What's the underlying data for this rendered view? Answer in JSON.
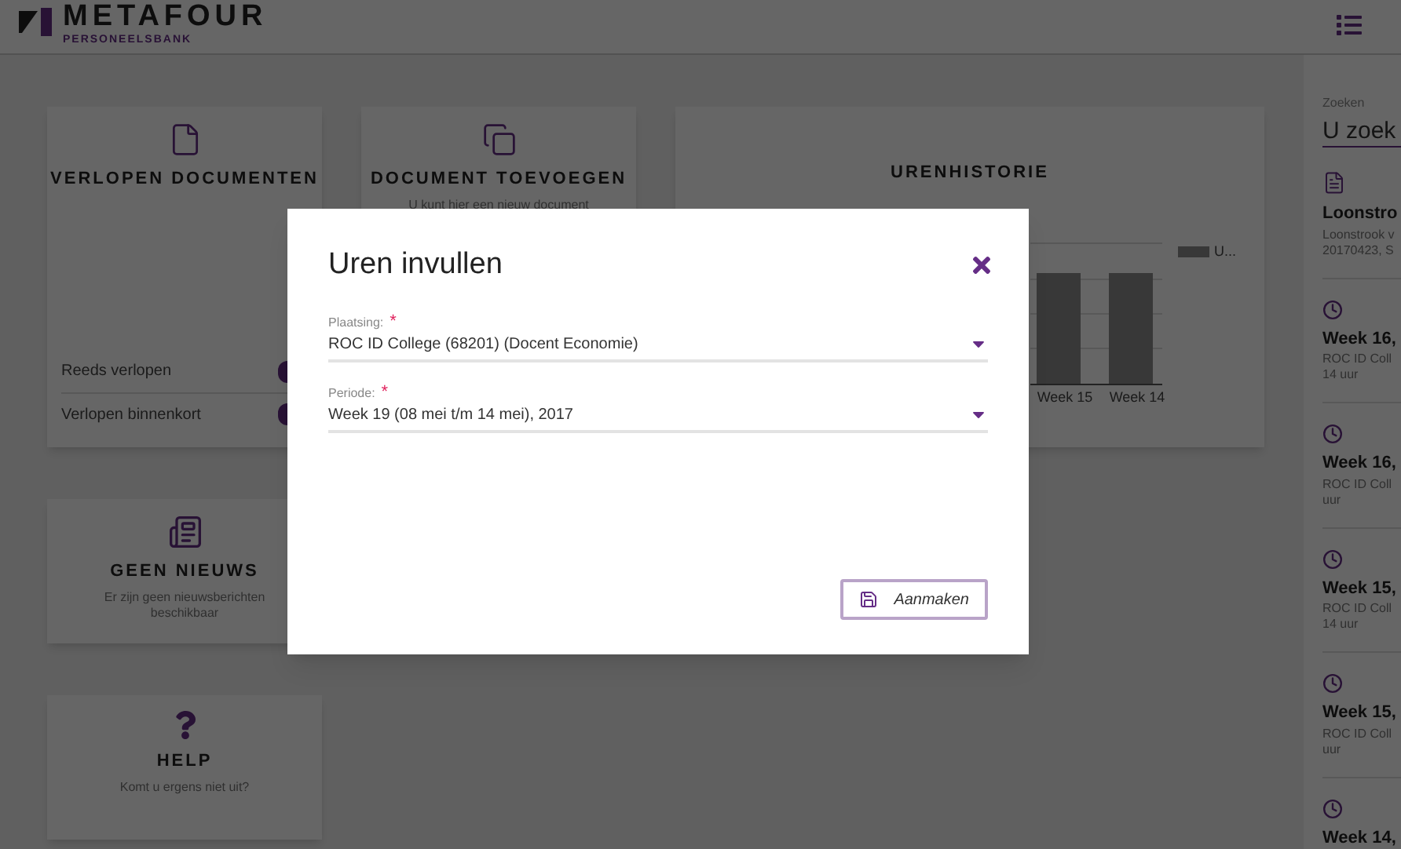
{
  "header": {
    "logo_name": "METAFOUR",
    "logo_subtitle": "PERSONEELSBANK"
  },
  "cards": [
    {
      "kind": "expired",
      "title": "VERLOPEN DOCUMENTEN",
      "rows": [
        "Reeds verlopen",
        "Verlopen binnenkort"
      ]
    },
    {
      "kind": "add",
      "title": "DOCUMENT TOEVOEGEN",
      "text": "U kunt hier een nieuw document"
    },
    {
      "kind": "chart",
      "title": "URENHISTORIE",
      "x_labels": [
        "Week 15",
        "Week 14"
      ],
      "legend": "U..."
    },
    {
      "kind": "news",
      "title": "GEEN NIEUWS",
      "text": "Er zijn geen nieuwsberichten beschikbaar"
    },
    {
      "kind": "help",
      "title": "HELP",
      "text": "Komt u ergens niet uit?"
    }
  ],
  "sidebar": {
    "search_label": "Zoeken",
    "search_placeholder": "U zoek",
    "items": [
      {
        "kind": "document",
        "title": "Loonstro",
        "lines": [
          "Loonstrook v",
          "20170423, S"
        ]
      },
      {
        "kind": "hours",
        "title": "Week 16,",
        "lines": [
          "ROC ID Coll",
          "14 uur"
        ]
      },
      {
        "kind": "hours",
        "title": "Week 16,",
        "lines": [
          "ROC ID Coll",
          "uur"
        ]
      },
      {
        "kind": "hours",
        "title": "Week 15,",
        "lines": [
          "ROC ID Coll",
          "14 uur"
        ]
      },
      {
        "kind": "hours",
        "title": "Week 15,",
        "lines": [
          "ROC ID Coll",
          "uur"
        ]
      },
      {
        "kind": "hours",
        "title": "Week 14,"
      }
    ]
  },
  "dialog": {
    "title": "Uren invullen",
    "fields": [
      {
        "label": "Plaatsing:",
        "required_mark": "*",
        "value": "ROC ID College (68201) (Docent Economie)"
      },
      {
        "label": "Periode:",
        "required_mark": "*",
        "value": "Week 19 (08 mei t/m 14 mei), 2017"
      }
    ],
    "button": "Aanmaken"
  }
}
